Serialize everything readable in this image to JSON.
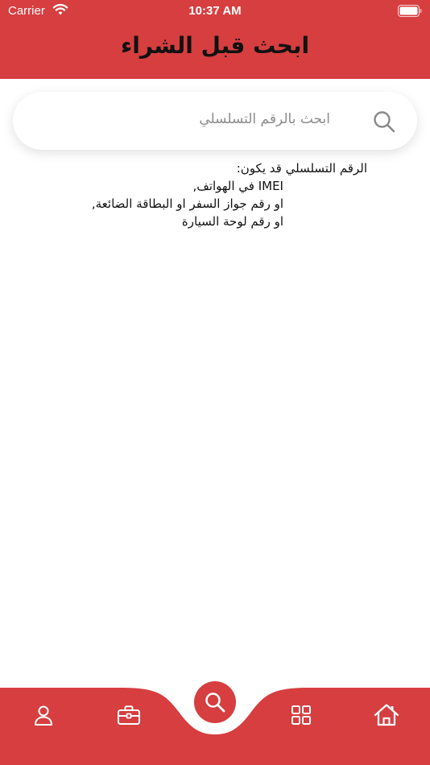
{
  "status_bar": {
    "carrier": "Carrier",
    "time": "10:37 AM"
  },
  "header": {
    "title": "ابحث قبل الشراء"
  },
  "search": {
    "placeholder": "ابحث بالرقم التسلسلي"
  },
  "info": {
    "heading": "الرقم التسلسلي قد يكون:",
    "lines": [
      "IMEI في الهواتف,",
      "او رقم جواز السفر او البطاقة الضائعة,",
      "او رقم لوحة السيارة"
    ]
  },
  "bottom_nav": {
    "items": [
      {
        "icon": "profile-icon"
      },
      {
        "icon": "briefcase-icon"
      },
      {
        "icon": "search-icon"
      },
      {
        "icon": "grid-icon"
      },
      {
        "icon": "home-icon"
      }
    ]
  },
  "colors": {
    "primary": "#d63e40",
    "text": "#111111",
    "placeholder": "#8c8c8c"
  }
}
